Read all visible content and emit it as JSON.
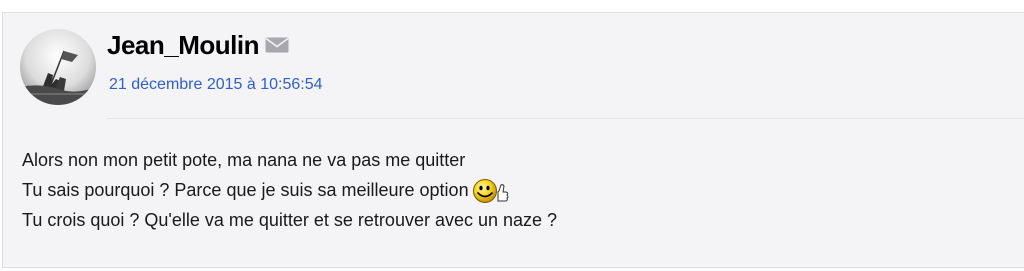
{
  "post": {
    "author": "Jean_Moulin",
    "date": "21 décembre 2015 à 10:56:54",
    "message_lines": [
      "Alors non mon petit pote, ma nana ne va pas me quitter",
      "Tu sais pourquoi ? Parce que je suis sa meilleure option",
      "Tu crois quoi ? Qu'elle va me quitter et se retrouver avec un naze ?"
    ],
    "icons": {
      "mail": "mail-icon",
      "smiley": "cool-smiley-icon"
    },
    "colors": {
      "date_link": "#2e5fd0",
      "background": "#f4f4f6",
      "author": "#000000"
    }
  }
}
